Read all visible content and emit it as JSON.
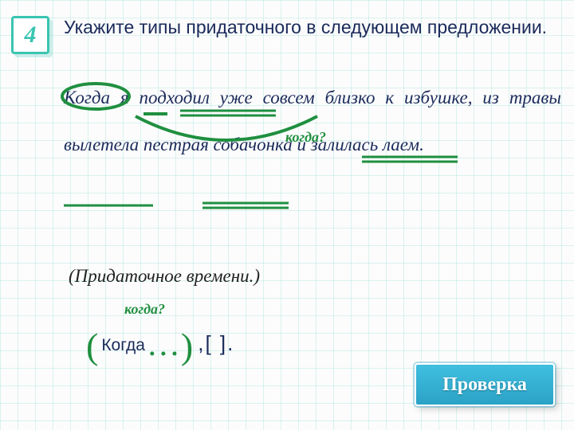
{
  "badge": {
    "number": "4"
  },
  "task": "Укажите типы придаточного в следующем предложении.",
  "sentence": "Когда я подходил уже совсем близко к избушке, из травы вылетела пестрая собачонка и залилась лаем.",
  "annotation_labels": {
    "question_main": "когда?",
    "question_scheme": "когда?"
  },
  "answer": "(Придаточное времени.)",
  "scheme": {
    "open": "(",
    "when": "Когда",
    "dots": "…",
    "close": ")",
    "tail": ",[    ]",
    "period": "."
  },
  "button": {
    "check": "Проверка"
  }
}
